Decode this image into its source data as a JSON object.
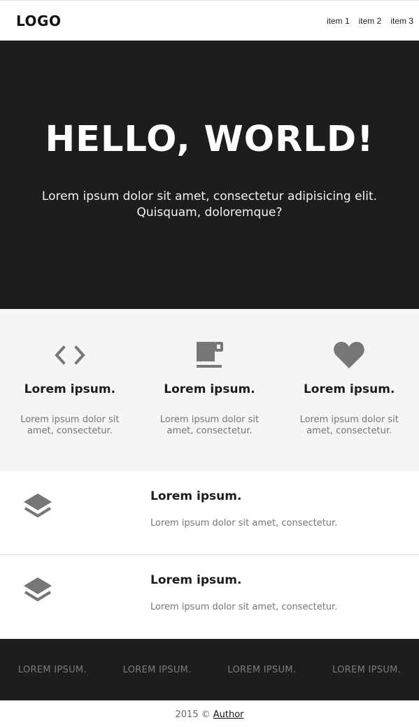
{
  "header": {
    "logo": "LOGO",
    "nav": [
      "item 1",
      "item 2",
      "item 3"
    ]
  },
  "hero": {
    "title": "HELLO, WORLD!",
    "subtitle_line1": "Lorem ipsum dolor sit amet, consectetur adipisicing elit.",
    "subtitle_line2": "Quisquam, doloremque?"
  },
  "features": [
    {
      "icon": "code-icon",
      "title": "Lorem ipsum.",
      "text_line1": "Lorem ipsum dolor sit",
      "text_line2": "amet, consectetur."
    },
    {
      "icon": "coffee-cup-icon",
      "title": "Lorem ipsum.",
      "text_line1": "Lorem ipsum dolor sit",
      "text_line2": "amet, consectetur."
    },
    {
      "icon": "heart-icon",
      "title": "Lorem ipsum.",
      "text_line1": "Lorem ipsum dolor sit",
      "text_line2": "amet, consectetur."
    }
  ],
  "rows": [
    {
      "icon": "layers-icon",
      "title": "Lorem ipsum.",
      "text": "Lorem ipsum dolor sit amet, consectetur."
    },
    {
      "icon": "layers-icon",
      "title": "Lorem ipsum.",
      "text": "Lorem ipsum dolor sit amet, consectetur."
    }
  ],
  "footer": {
    "links": [
      "LOREM IPSUM.",
      "LOREM IPSUM.",
      "LOREM IPSUM.",
      "LOREM IPSUM."
    ],
    "copyright": "2015 ©",
    "author": "Author"
  },
  "colors": {
    "dark": "#1d1d1d",
    "light_section": "#f5f5f5",
    "icon_gray": "#777777",
    "muted_text": "#757575"
  }
}
